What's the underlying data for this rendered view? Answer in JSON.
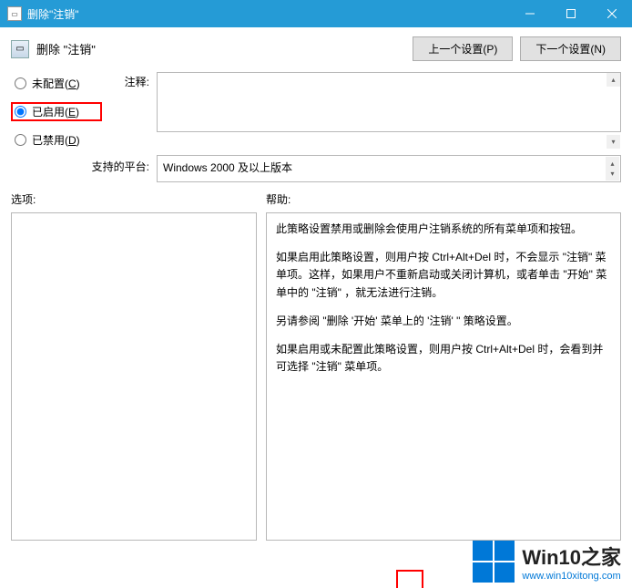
{
  "titlebar": {
    "title": "删除\"注销\""
  },
  "header": {
    "title": "删除 \"注销\"",
    "prev_btn": "上一个设置(P)",
    "next_btn": "下一个设置(N)"
  },
  "radios": {
    "not_configured": "未配置(C)",
    "enabled": "已启用(E)",
    "disabled": "已禁用(D)",
    "selected": "enabled"
  },
  "labels": {
    "comment": "注释:",
    "platform": "支持的平台:",
    "options": "选项:",
    "help": "帮助:"
  },
  "platform_value": "Windows 2000 及以上版本",
  "help_text": {
    "p1": "此策略设置禁用或删除会使用户注销系统的所有菜单项和按钮。",
    "p2": "如果启用此策略设置，则用户按 Ctrl+Alt+Del 时，不会显示 \"注销\" 菜单项。这样，如果用户不重新启动或关闭计算机，或者单击 \"开始\" 菜单中的 \"注销\" ，就无法进行注销。",
    "p3": "另请参阅 \"删除 '开始' 菜单上的 '注销' \" 策略设置。",
    "p4": "如果启用或未配置此策略设置，则用户按 Ctrl+Alt+Del 时，会看到并可选择 \"注销\" 菜单项。"
  },
  "watermark": {
    "main": "Win10之家",
    "sub": "www.win10xitong.com"
  }
}
